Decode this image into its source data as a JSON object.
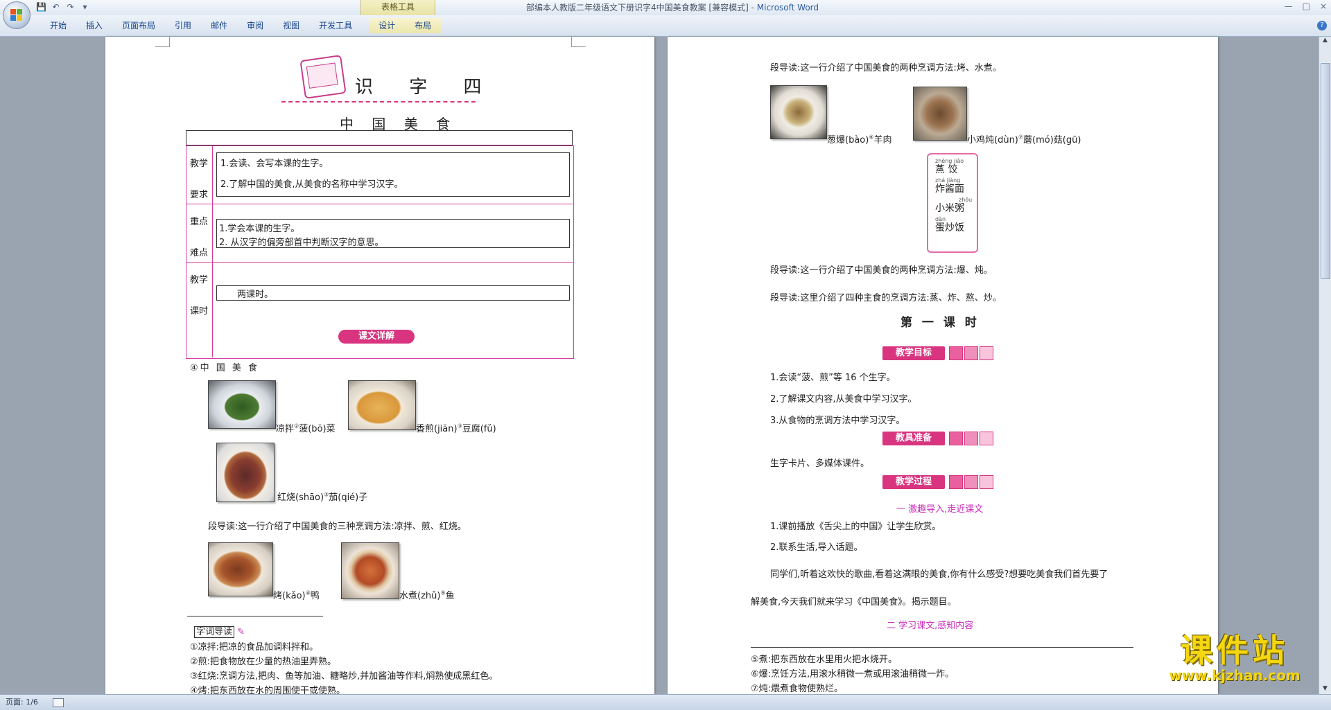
{
  "window": {
    "title": "部编本人教版二年级语文下册识字4中国美食教案 [兼容模式] - ",
    "app_name": "Microsoft Word",
    "context_tab_group": "表格工具",
    "controls": [
      "—",
      "□",
      "×"
    ]
  },
  "ribbon": {
    "tabs": [
      "开始",
      "插入",
      "页面布局",
      "引用",
      "邮件",
      "审阅",
      "视图",
      "开发工具",
      "设计",
      "布局"
    ]
  },
  "status": {
    "page": "页面: 1/6"
  },
  "page1": {
    "lesson_title": "识 字 四",
    "subtitle": "中 国 美 食",
    "table": {
      "row1_label": [
        "教学",
        "要求"
      ],
      "row1_items": [
        "1.会读、会写本课的生字。",
        "2.了解中国的美食,从美食的名称中学习汉字。"
      ],
      "row2_label": [
        "重点",
        "难点"
      ],
      "row2_items": [
        "1.学会本课的生字。",
        "2.  从汉字的偏旁部首中判断汉字的意思。"
      ],
      "row3_label": [
        "教学",
        "课时"
      ],
      "row3_value": "两课时。"
    },
    "section_tag": "课文详解",
    "text_title": "④中 国 美 食",
    "dishes": [
      {
        "label": "凉拌",
        "sup": "②",
        "label2": "菠(bō)菜"
      },
      {
        "label": "香煎(jiān)",
        "sup": "③",
        "label2": "豆腐(fǔ)"
      },
      {
        "label": "红烧(shāo)",
        "sup": "③",
        "label2": "茄(qié)子"
      },
      {
        "label": "烤(kǎo)",
        "sup": "④",
        "label2": "鸭"
      },
      {
        "label": "水煮(zhǔ)",
        "sup": "⑤",
        "label2": "鱼"
      }
    ],
    "guide1": "段导读:这一行介绍了中国美食的三种烹调方法:凉拌、煎、红烧。",
    "vocab_tag": "字词导读",
    "vocab": [
      "①凉拌:把凉的食品加调料拌和。",
      "②煎:把食物放在少量的热油里弄熟。",
      "③红烧:烹调方法,把肉、鱼等加油、糖略炒,并加酱油等作料,焖熟使成黑红色。",
      "④烤:把东西放在水的周围使干或使熟。"
    ]
  },
  "page2": {
    "guide_top": "段导读:这一行介绍了中国美食的两种烹调方法:烤、水煮。",
    "dishes": [
      {
        "label": "葱爆(bào)",
        "sup": "⑥",
        "label2": "羊肉"
      },
      {
        "label": "小鸡炖(dùn)",
        "sup": "⑦",
        "label2": "蘑(mó)菇(gū)"
      }
    ],
    "staples": [
      {
        "py": "zhēng jiǎo",
        "hz": "蒸  饺"
      },
      {
        "py": "zhá jiàng",
        "hz": "炸酱面"
      },
      {
        "py": "zhōu",
        "hz": "小米粥"
      },
      {
        "py": "dàn",
        "hz": "蛋炒饭"
      }
    ],
    "guide2": "段导读:这一行介绍了中国美食的两种烹调方法:爆、炖。",
    "guide3": "段导读:这里介绍了四种主食的烹调方法:蒸、炸、熬、炒。",
    "lesson_heading": "第 一 课 时",
    "goals_tag": "教学目标",
    "goals": [
      "1.会读“菠、煎”等 16 个生字。",
      "2.了解课文内容,从美食中学习汉字。",
      "3.从食物的烹调方法中学习汉字。"
    ],
    "tools_tag": "教具准备",
    "tools": "生字卡片、多媒体课件。",
    "process_tag": "教学过程",
    "step1_title": "一   激趣导入,走近课文",
    "step1_items": [
      "1.课前播放《舌尖上的中国》让学生欣赏。",
      "2.联系生活,导入话题。"
    ],
    "intro_line1": "同学们,听着这欢快的歌曲,看着这满眼的美食,你有什么感受?想要吃美食我们首先要了",
    "intro_line2": "解美食,今天我们就来学习《中国美食》。揭示题目。",
    "step2_title": "二   学习课文,感知内容",
    "notes": [
      "⑤煮:把东西放在水里用火把水烧开。",
      "⑥爆:烹饪方法,用滚水稍微一煮或用滚油稍微一炸。",
      "⑦炖:煨煮食物使熟烂。"
    ]
  },
  "watermark": {
    "main": "课件站",
    "url": "www.kjzhan.com"
  }
}
